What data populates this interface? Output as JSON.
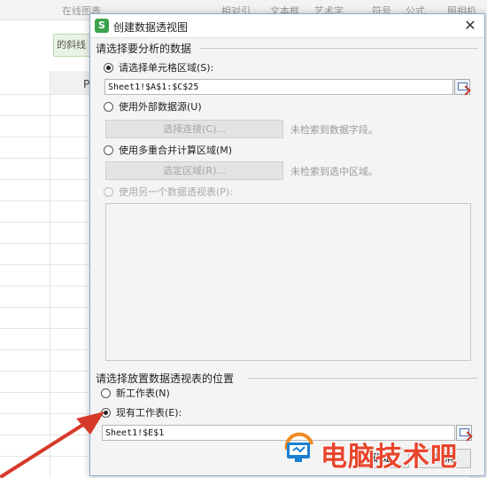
{
  "ribbon": {
    "items": [
      "在线图表",
      "相对引用",
      "文本框",
      "艺术字",
      "符号",
      "公式",
      "照相机"
    ]
  },
  "sheet": {
    "tab_label": "的斜线",
    "column_label": "P"
  },
  "dialog": {
    "app_icon": "S",
    "title": "创建数据透视图",
    "close_label": "✕",
    "section_source": {
      "title": "请选择要分析的数据",
      "option_range": {
        "label": "请选择单元格区域(S):",
        "checked": true,
        "value": "Sheet1!$A$1:$C$25"
      },
      "option_external": {
        "label": "使用外部数据源(U)",
        "checked": false,
        "button_label": "选择连接(C)...",
        "hint": "未检索到数据字段。"
      },
      "option_multi": {
        "label": "使用多重合并计算区域(M)",
        "checked": false,
        "button_label": "选定区域(R)...",
        "hint": "未检索到选中区域。"
      },
      "option_other_pivot": {
        "label": "使用另一个数据透视表(P):",
        "checked": false,
        "disabled": true
      }
    },
    "section_location": {
      "title": "请选择放置数据透视表的位置",
      "option_new": {
        "label": "新工作表(N)",
        "checked": false
      },
      "option_existing": {
        "label": "现有工作表(E):",
        "checked": true,
        "value": "Sheet1!$E$1"
      }
    },
    "ok_label": "确定",
    "cancel_label": "取消"
  },
  "watermark": {
    "text": "电脑技术吧"
  },
  "icons": {
    "picker": "range-picker-icon",
    "arrow": "red-arrow-annotation"
  },
  "colors": {
    "accent_green": "#3aa44a",
    "arrow_red": "#d63a2a",
    "watermark_red": "#e8452c",
    "watermark_blue": "#1b7fd1"
  }
}
